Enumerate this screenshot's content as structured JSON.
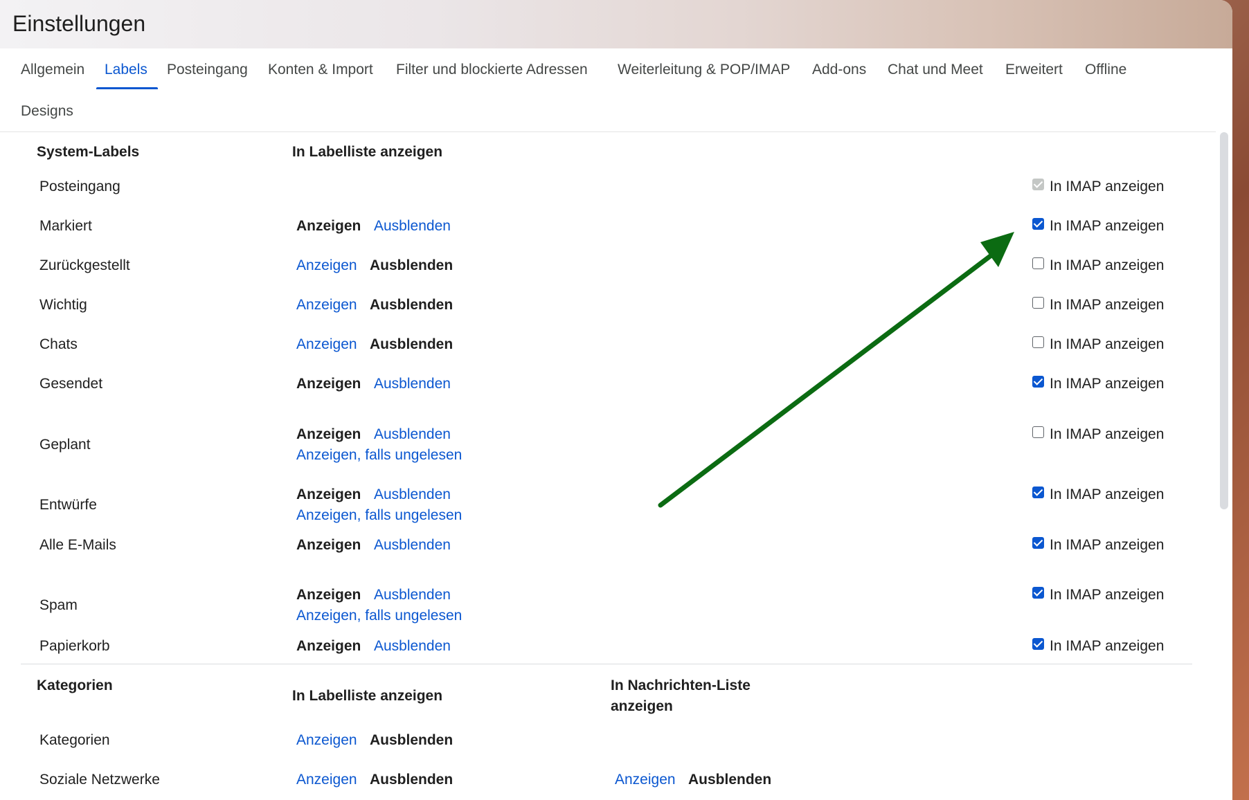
{
  "window": {
    "title": "Einstellungen"
  },
  "tabs": [
    {
      "label": "Allgemein"
    },
    {
      "label": "Labels",
      "active": true
    },
    {
      "label": "Posteingang"
    },
    {
      "label": "Konten & Import"
    },
    {
      "label": "Filter und blockierte Adressen"
    },
    {
      "label": "Weiterleitung & POP/IMAP"
    },
    {
      "label": "Add-ons"
    },
    {
      "label": "Chat und Meet"
    },
    {
      "label": "Erweitert"
    },
    {
      "label": "Offline"
    },
    {
      "label": "Designs"
    }
  ],
  "system_labels": {
    "header": "System-Labels",
    "list_header": "In Labelliste anzeigen",
    "show_label": "Anzeigen",
    "hide_label": "Ausblenden",
    "show_unread_label": "Anzeigen, falls ungelesen",
    "imap_label": "In IMAP anzeigen",
    "rows": [
      {
        "name": "Posteingang",
        "imap_checked": true,
        "imap_disabled": true
      },
      {
        "name": "Markiert",
        "selected": "Anzeigen",
        "imap_checked": true
      },
      {
        "name": "Zurückgestellt",
        "selected": "Ausblenden",
        "imap_checked": false
      },
      {
        "name": "Wichtig",
        "selected": "Ausblenden",
        "imap_checked": false
      },
      {
        "name": "Chats",
        "selected": "Ausblenden",
        "imap_checked": false
      },
      {
        "name": "Gesendet",
        "selected": "Anzeigen",
        "imap_checked": true
      },
      {
        "name": "Geplant",
        "selected": "Anzeigen",
        "has_unread_option": true,
        "imap_checked": false
      },
      {
        "name": "Entwürfe",
        "selected": "Anzeigen",
        "has_unread_option": true,
        "imap_checked": true
      },
      {
        "name": "Alle E-Mails",
        "selected": "Anzeigen",
        "imap_checked": true
      },
      {
        "name": "Spam",
        "selected": "Anzeigen",
        "has_unread_option": true,
        "imap_checked": true
      },
      {
        "name": "Papierkorb",
        "selected": "Anzeigen",
        "imap_checked": true
      }
    ]
  },
  "categories": {
    "header": "Kategorien",
    "list_header": "In Labelliste anzeigen",
    "message_list_header_line1": "In Nachrichten-Liste",
    "message_list_header_line2": "anzeigen",
    "rows": [
      {
        "name": "Kategorien",
        "selected": "Ausblenden"
      },
      {
        "name": "Soziale Netzwerke",
        "selected": "Ausblenden",
        "msg_selected": "Ausblenden"
      }
    ]
  },
  "annotation": {
    "arrow_color": "#0b6b12"
  }
}
